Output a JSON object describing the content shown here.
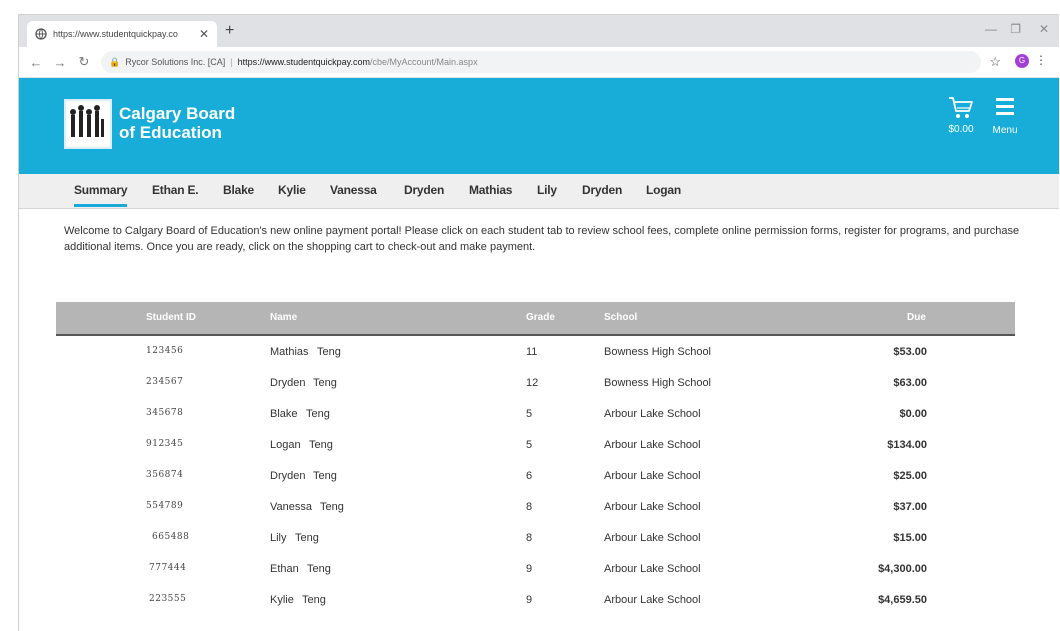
{
  "browser": {
    "tab_title": "https://www.studentquickpay.co",
    "new_tab": "+",
    "site_identity": "Rycor Solutions Inc. [CA]",
    "url_host": "https://www.studentquickpay.com",
    "url_path": "/cbe/MyAccount/Main.aspx",
    "profile_initial": "G"
  },
  "header": {
    "org_line1": "Calgary Board",
    "org_line2": "of Education",
    "cart_total": "$0.00",
    "menu_label": "Menu"
  },
  "tabs": [
    {
      "label": "Summary",
      "active": true
    },
    {
      "label": "Ethan E."
    },
    {
      "label": "Blake"
    },
    {
      "label": "Kylie"
    },
    {
      "label": "Vanessa"
    },
    {
      "label": "Dryden"
    },
    {
      "label": "Mathias"
    },
    {
      "label": "Lily"
    },
    {
      "label": "Dryden"
    },
    {
      "label": "Logan"
    }
  ],
  "welcome_text": "Welcome to Calgary Board of Education's new online payment portal! Please click on each student tab to review school fees, complete online permission forms, register for programs, and purchase additional items. Once you are ready, click on the shopping cart to check-out and make payment.",
  "table": {
    "headers": {
      "student_id": "Student ID",
      "name": "Name",
      "grade": "Grade",
      "school": "School",
      "due": "Due"
    },
    "rows": [
      {
        "id": "123456",
        "first": "Mathias",
        "last": "Teng",
        "grade": "11",
        "school": "Bowness High School",
        "due": "$53.00"
      },
      {
        "id": "234567",
        "first": "Dryden",
        "last": "Teng",
        "grade": "12",
        "school": "Bowness High School",
        "due": "$63.00"
      },
      {
        "id": "345678",
        "first": "Blake",
        "last": "Teng",
        "grade": "5",
        "school": "Arbour Lake School",
        "due": "$0.00"
      },
      {
        "id": "912345",
        "first": "Logan",
        "last": "Teng",
        "grade": "5",
        "school": "Arbour Lake School",
        "due": "$134.00"
      },
      {
        "id": "356874",
        "first": "Dryden",
        "last": "Teng",
        "grade": "6",
        "school": "Arbour Lake School",
        "due": "$25.00"
      },
      {
        "id": "554789",
        "first": "Vanessa",
        "last": "Teng",
        "grade": "8",
        "school": "Arbour Lake School",
        "due": "$37.00"
      },
      {
        "id": "665488",
        "first": "Lily",
        "last": "Teng",
        "grade": "8",
        "school": "Arbour Lake School",
        "due": "$15.00"
      },
      {
        "id": "777444",
        "first": "Ethan",
        "last": "Teng",
        "grade": "9",
        "school": "Arbour Lake School",
        "due": "$4,300.00"
      },
      {
        "id": "223555",
        "first": "Kylie",
        "last": "Teng",
        "grade": "9",
        "school": "Arbour Lake School",
        "due": "$4,659.50"
      }
    ]
  },
  "colors": {
    "brand": "#18add8",
    "header_row": "#b5b5b5",
    "tab_underline": "#1aa8d6"
  }
}
